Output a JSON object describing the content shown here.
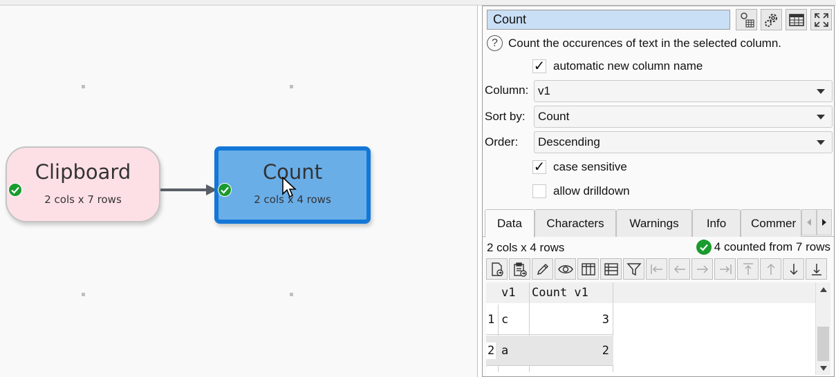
{
  "canvas": {
    "nodes": [
      {
        "title": "Clipboard",
        "sub": "2 cols x 7 rows"
      },
      {
        "title": "Count",
        "sub": "2 cols x 4 rows"
      }
    ]
  },
  "panel": {
    "title_value": "Count",
    "help_text": "Count the occurences of text in the selected column.",
    "auto_name_label": "automatic new column name",
    "column": {
      "label": "Column:",
      "value": "v1"
    },
    "sort": {
      "label": "Sort by:",
      "value": "Count"
    },
    "order": {
      "label": "Order:",
      "value": "Descending"
    },
    "case_label": "case sensitive",
    "drill_label": "allow drilldown",
    "tabs": [
      "Data",
      "Characters",
      "Warnings",
      "Info",
      "Commer"
    ],
    "status_left": "2 cols x 4 rows",
    "status_right": "4 counted from 7 rows",
    "grid": {
      "headers": [
        "v1",
        "Count v1"
      ],
      "rows": [
        {
          "n": "1",
          "v1": "c",
          "count": "3"
        },
        {
          "n": "2",
          "v1": "a",
          "count": "2"
        }
      ]
    }
  },
  "colors": {
    "selected_node_fill": "#6aaee8",
    "selected_node_border": "#1377d8",
    "clipboard_node_fill": "#fde0e6",
    "ok_green": "#1a9b2e",
    "title_field": "#c9dff5"
  }
}
